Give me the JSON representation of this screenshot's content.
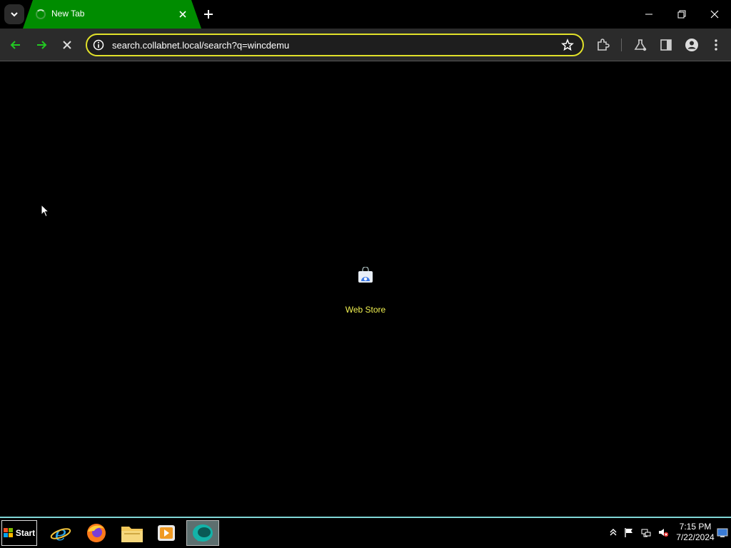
{
  "browser": {
    "tab": {
      "title": "New Tab"
    },
    "address_bar": {
      "url": "search.collabnet.local/search?q=wincdemu"
    }
  },
  "content": {
    "shortcuts": [
      {
        "label": "Web Store",
        "icon": "web-store-icon"
      }
    ]
  },
  "taskbar": {
    "start_label": "Start",
    "apps": [
      {
        "name": "internet-explorer-icon"
      },
      {
        "name": "firefox-icon"
      },
      {
        "name": "file-explorer-icon"
      },
      {
        "name": "media-player-icon"
      },
      {
        "name": "browser-app-icon",
        "active": true
      }
    ],
    "clock": {
      "time": "7:15 PM",
      "date": "7/22/2024"
    }
  },
  "colors": {
    "tab_active": "#008c00",
    "omnibox_border": "#e1e12a",
    "nav_arrow": "#22c922",
    "shortcut_label": "#f0f050",
    "taskbar_border": "#7fd6d6"
  }
}
